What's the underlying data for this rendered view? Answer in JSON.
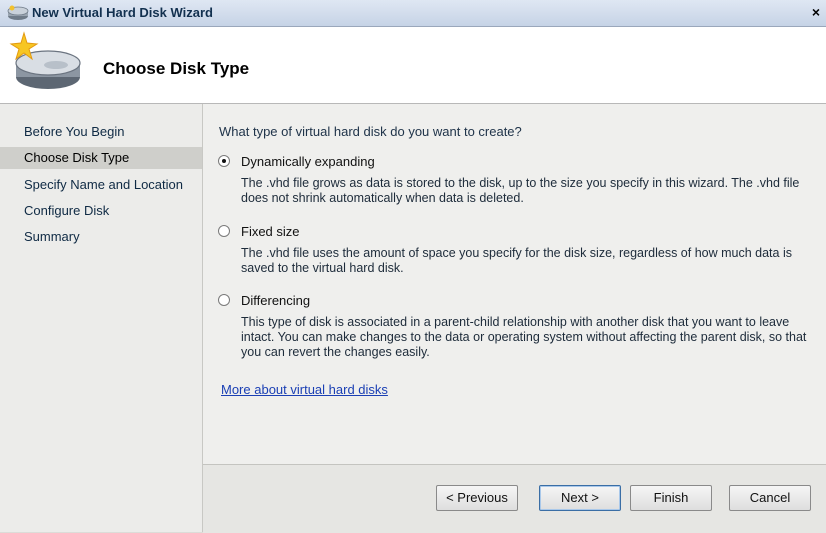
{
  "window": {
    "title": "New Virtual Hard Disk Wizard",
    "close_symbol": "×"
  },
  "header": {
    "title": "Choose Disk Type",
    "icon": "hard-disk-with-sparkle-icon"
  },
  "nav": {
    "items": [
      {
        "label": "Before You Begin",
        "active": false
      },
      {
        "label": "Choose Disk Type",
        "active": true
      },
      {
        "label": "Specify Name and Location",
        "active": false
      },
      {
        "label": "Configure Disk",
        "active": false
      },
      {
        "label": "Summary",
        "active": false
      }
    ]
  },
  "main": {
    "question": "What type of virtual hard disk do you want to create?",
    "options": [
      {
        "label": "Dynamically expanding",
        "checked": true,
        "description": "The .vhd file grows as data is stored to the disk, up to the size you specify in this wizard. The .vhd file does not shrink automatically when data is deleted."
      },
      {
        "label": "Fixed size",
        "checked": false,
        "description": "The .vhd file uses the amount of space you specify for the disk size, regardless of how much data is saved to the virtual hard disk."
      },
      {
        "label": "Differencing",
        "checked": false,
        "description": "This type of disk is associated in a parent-child relationship with another disk that you want to leave intact. You can make changes to the data or operating system without affecting the parent disk, so that you can revert the changes easily."
      }
    ],
    "link": "More about virtual hard disks"
  },
  "footer": {
    "previous": "< Previous",
    "next": "Next >",
    "finish": "Finish",
    "cancel": "Cancel"
  }
}
